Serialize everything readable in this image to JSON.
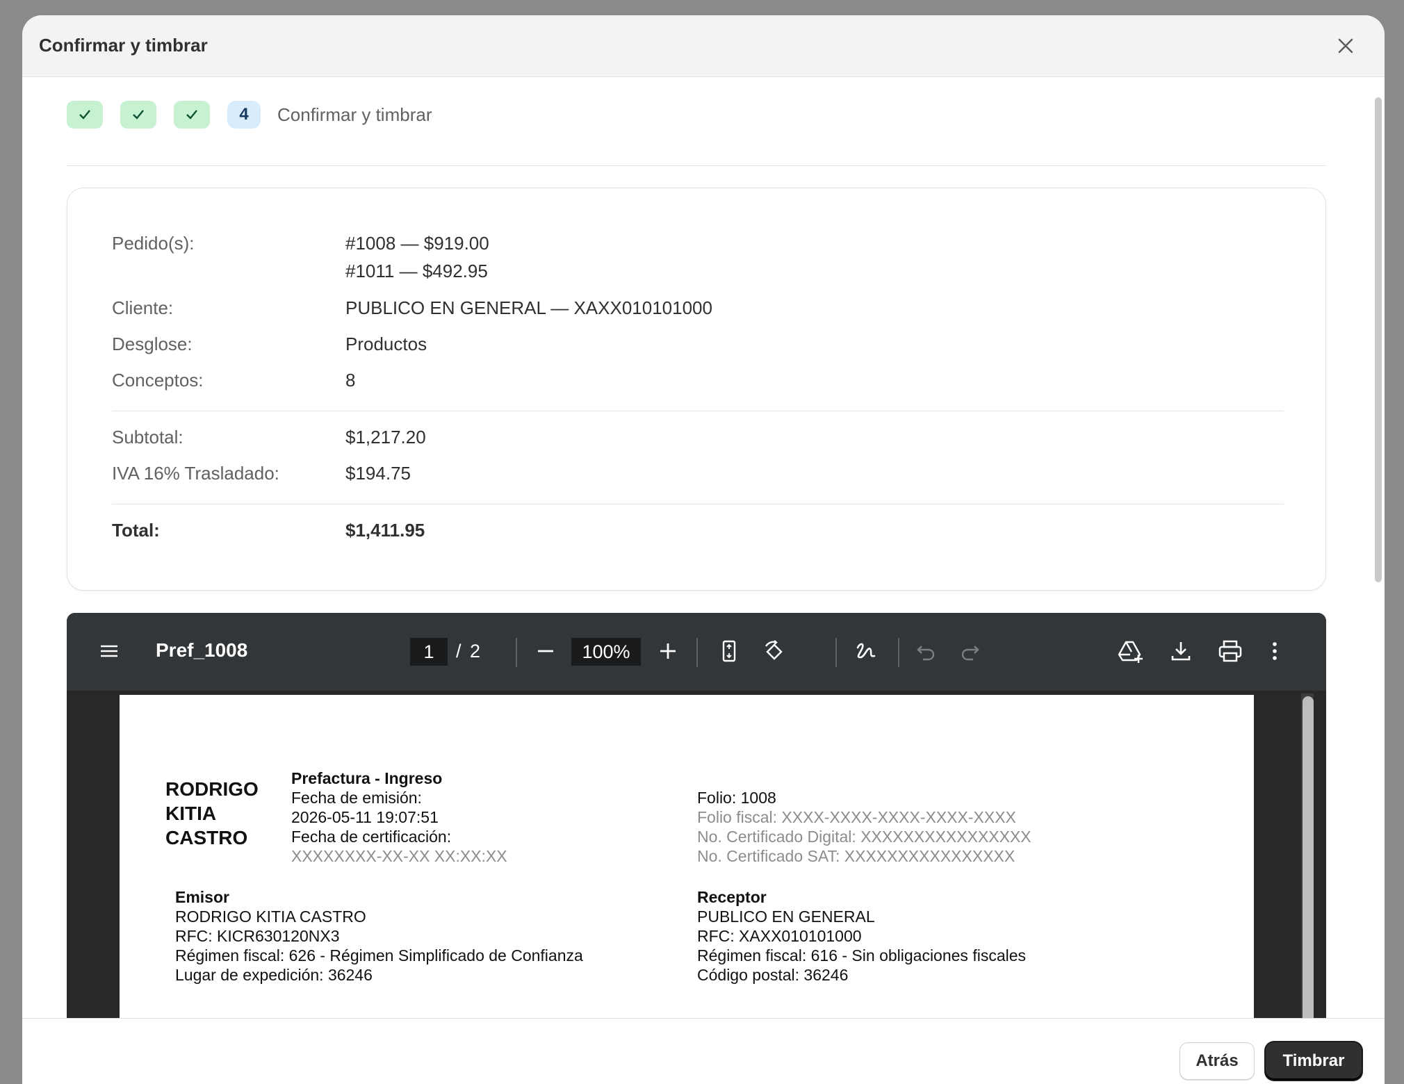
{
  "modal": {
    "title": "Confirmar y timbrar",
    "close_icon": "close-icon"
  },
  "steps": {
    "completed": [
      {
        "icon": "checkmark-icon"
      },
      {
        "icon": "checkmark-icon"
      },
      {
        "icon": "checkmark-icon"
      }
    ],
    "current_number": "4",
    "current_label": "Confirmar y timbrar"
  },
  "summary": {
    "orders_label": "Pedido(s):",
    "orders": [
      "#1008 — $919.00",
      "#1011 — $492.95"
    ],
    "client_label": "Cliente:",
    "client_value": "PUBLICO EN GENERAL — XAXX010101000",
    "breakdown_label": "Desglose:",
    "breakdown_value": "Productos",
    "concepts_label": "Conceptos:",
    "concepts_value": "8",
    "subtotal_label": "Subtotal:",
    "subtotal_value": "$1,217.20",
    "iva_label": "IVA 16% Trasladado:",
    "iva_value": "$194.75",
    "total_label": "Total:",
    "total_value": "$1,411.95"
  },
  "pdf": {
    "filename": "Pref_1008",
    "current_page": "1",
    "page_separator": "/",
    "total_pages": "2",
    "zoom": "100%",
    "icons": {
      "menu": "menu-icon",
      "zoom_out": "minus-icon",
      "zoom_in": "plus-icon",
      "fit": "fit-page-icon",
      "rotate": "rotate-icon",
      "annotate": "draw-icon",
      "undo": "undo-icon",
      "redo": "redo-icon",
      "drive": "save-to-drive-icon",
      "download": "download-icon",
      "print": "print-icon",
      "more": "more-vert-icon"
    },
    "document": {
      "issuer_name_lines": [
        "RODRIGO",
        "KITIA",
        "CASTRO"
      ],
      "doc_type": "Prefactura - Ingreso",
      "issue_date_label": "Fecha de emisión:",
      "issue_date": "2026-05-11 19:07:51",
      "cert_date_label": "Fecha de certificación:",
      "cert_date": "XXXXXXXX-XX-XX XX:XX:XX",
      "folio": "Folio: 1008",
      "folio_fiscal": "Folio fiscal: XXXX-XXXX-XXXX-XXXX-XXXX",
      "cert_digital": "No. Certificado Digital: XXXXXXXXXXXXXXXX",
      "cert_sat": "No. Certificado SAT: XXXXXXXXXXXXXXXX",
      "emisor": {
        "heading": "Emisor",
        "name": "RODRIGO KITIA CASTRO",
        "rfc": "RFC: KICR630120NX3",
        "regime": "Régimen fiscal: 626 - Régimen Simplificado de Confianza",
        "place": "Lugar de expedición: 36246"
      },
      "receptor": {
        "heading": "Receptor",
        "name": "PUBLICO EN GENERAL",
        "rfc": "RFC: XAXX010101000",
        "regime": "Régimen fiscal: 616 - Sin obligaciones fiscales",
        "postal": "Código postal: 36246"
      }
    }
  },
  "footer": {
    "back_label": "Atrás",
    "primary_label": "Timbrar"
  }
}
